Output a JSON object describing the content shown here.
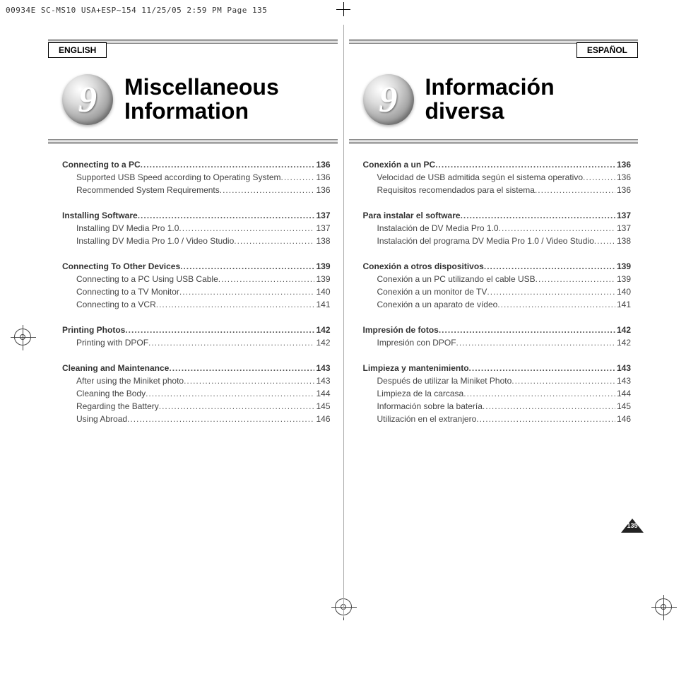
{
  "print_header": "00934E SC-MS10 USA+ESP~154  11/25/05 2:59 PM  Page 135",
  "left": {
    "lang": "ENGLISH",
    "chapter_number": "9",
    "title_line1": "Miscellaneous",
    "title_line2": "Information",
    "toc": [
      {
        "label": "Connecting to a PC",
        "page": "136",
        "main": true
      },
      {
        "label": "Supported USB Speed according to Operating System",
        "page": "136",
        "main": false
      },
      {
        "label": "Recommended System Requirements",
        "page": "136",
        "main": false
      },
      {
        "label": "Installing Software",
        "page": "137",
        "main": true
      },
      {
        "label": "Installing DV Media Pro 1.0",
        "page": "137",
        "main": false
      },
      {
        "label": "Installing DV Media Pro 1.0 / Video Studio",
        "page": "138",
        "main": false
      },
      {
        "label": "Connecting To Other Devices",
        "page": "139",
        "main": true
      },
      {
        "label": "Connecting to a PC Using USB Cable",
        "page": "139",
        "main": false
      },
      {
        "label": "Connecting to a TV Monitor",
        "page": "140",
        "main": false
      },
      {
        "label": "Connecting to a VCR",
        "page": "141",
        "main": false
      },
      {
        "label": "Printing Photos",
        "page": "142",
        "main": true
      },
      {
        "label": "Printing with DPOF",
        "page": "142",
        "main": false
      },
      {
        "label": "Cleaning and Maintenance",
        "page": "143",
        "main": true
      },
      {
        "label": "After using the Miniket photo",
        "page": "143",
        "main": false
      },
      {
        "label": "Cleaning the Body",
        "page": "144",
        "main": false
      },
      {
        "label": "Regarding the Battery",
        "page": "145",
        "main": false
      },
      {
        "label": "Using Abroad",
        "page": "146",
        "main": false
      }
    ]
  },
  "right": {
    "lang": "ESPAÑOL",
    "chapter_number": "9",
    "title_line1": "Información",
    "title_line2": "diversa",
    "toc": [
      {
        "label": "Conexión a un PC",
        "page": "136",
        "main": true
      },
      {
        "label": "Velocidad de USB admitida según el sistema operativo",
        "page": "136",
        "main": false
      },
      {
        "label": "Requisitos recomendados para el sistema",
        "page": "136",
        "main": false
      },
      {
        "label": "Para instalar el software",
        "page": "137",
        "main": true
      },
      {
        "label": "Instalación de DV Media Pro 1.0",
        "page": "137",
        "main": false
      },
      {
        "label": "Instalación del programa DV Media Pro 1.0 / Video Studio",
        "page": "138",
        "main": false
      },
      {
        "label": "Conexión a otros dispositivos",
        "page": "139",
        "main": true
      },
      {
        "label": "Conexión a un PC utilizando el cable USB",
        "page": "139",
        "main": false
      },
      {
        "label": "Conexión a un monitor de TV",
        "page": "140",
        "main": false
      },
      {
        "label": "Conexión a un aparato de vídeo",
        "page": "141",
        "main": false
      },
      {
        "label": "Impresión de fotos",
        "page": "142",
        "main": true
      },
      {
        "label": "Impresión con DPOF",
        "page": "142",
        "main": false
      },
      {
        "label": "Limpieza y mantenimiento",
        "page": "143",
        "main": true
      },
      {
        "label": "Después de utilizar la Miniket Photo",
        "page": "143",
        "main": false
      },
      {
        "label": "Limpieza de la carcasa",
        "page": "144",
        "main": false
      },
      {
        "label": "Información sobre la batería",
        "page": "145",
        "main": false
      },
      {
        "label": "Utilización en el extranjero",
        "page": "146",
        "main": false
      }
    ]
  },
  "page_number": "135"
}
